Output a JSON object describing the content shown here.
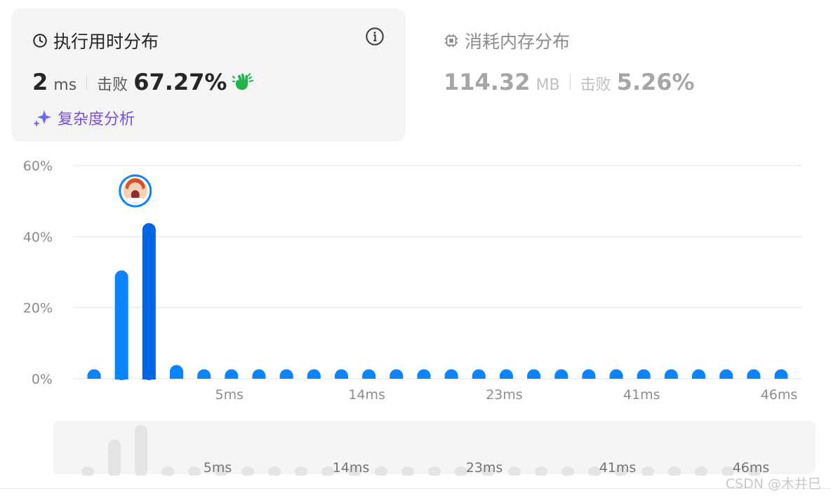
{
  "runtime": {
    "title": "执行用时分布",
    "value": "2",
    "unit": "ms",
    "beat_label": "击败",
    "beat_value": "67.27%",
    "analysis_label": "复杂度分析"
  },
  "memory": {
    "title": "消耗内存分布",
    "value": "114.32",
    "unit": "MB",
    "beat_label": "击败",
    "beat_value": "5.26%"
  },
  "colors": {
    "bar": "#0a84ff",
    "bar_selected": "#0066e6",
    "mini_bar": "#e4e4e4",
    "grid": "#ebebeb",
    "accent_green": "#20b24b",
    "analysis": "#7b4de0"
  },
  "chart_data": {
    "type": "bar",
    "ylim": [
      0,
      60
    ],
    "yticks": [
      "0%",
      "20%",
      "40%",
      "60%"
    ],
    "x_tick_labels": [
      {
        "index": 5,
        "label": "5ms"
      },
      {
        "index": 10,
        "label": "14ms"
      },
      {
        "index": 15,
        "label": "23ms"
      },
      {
        "index": 20,
        "label": "41ms"
      },
      {
        "index": 25,
        "label": "46ms"
      }
    ],
    "values": [
      0.8,
      30.5,
      43.8,
      2.0,
      0.8,
      0.8,
      0.8,
      0.8,
      0.8,
      0.8,
      0.8,
      0.8,
      0.8,
      0.8,
      0.8,
      0.8,
      0.8,
      0.8,
      0.8,
      0.8,
      0.8,
      0.8,
      0.8,
      0.8,
      0.8,
      0.8
    ],
    "selected_index": 2,
    "grid": true
  },
  "watermark": "CSDN @木井巳"
}
